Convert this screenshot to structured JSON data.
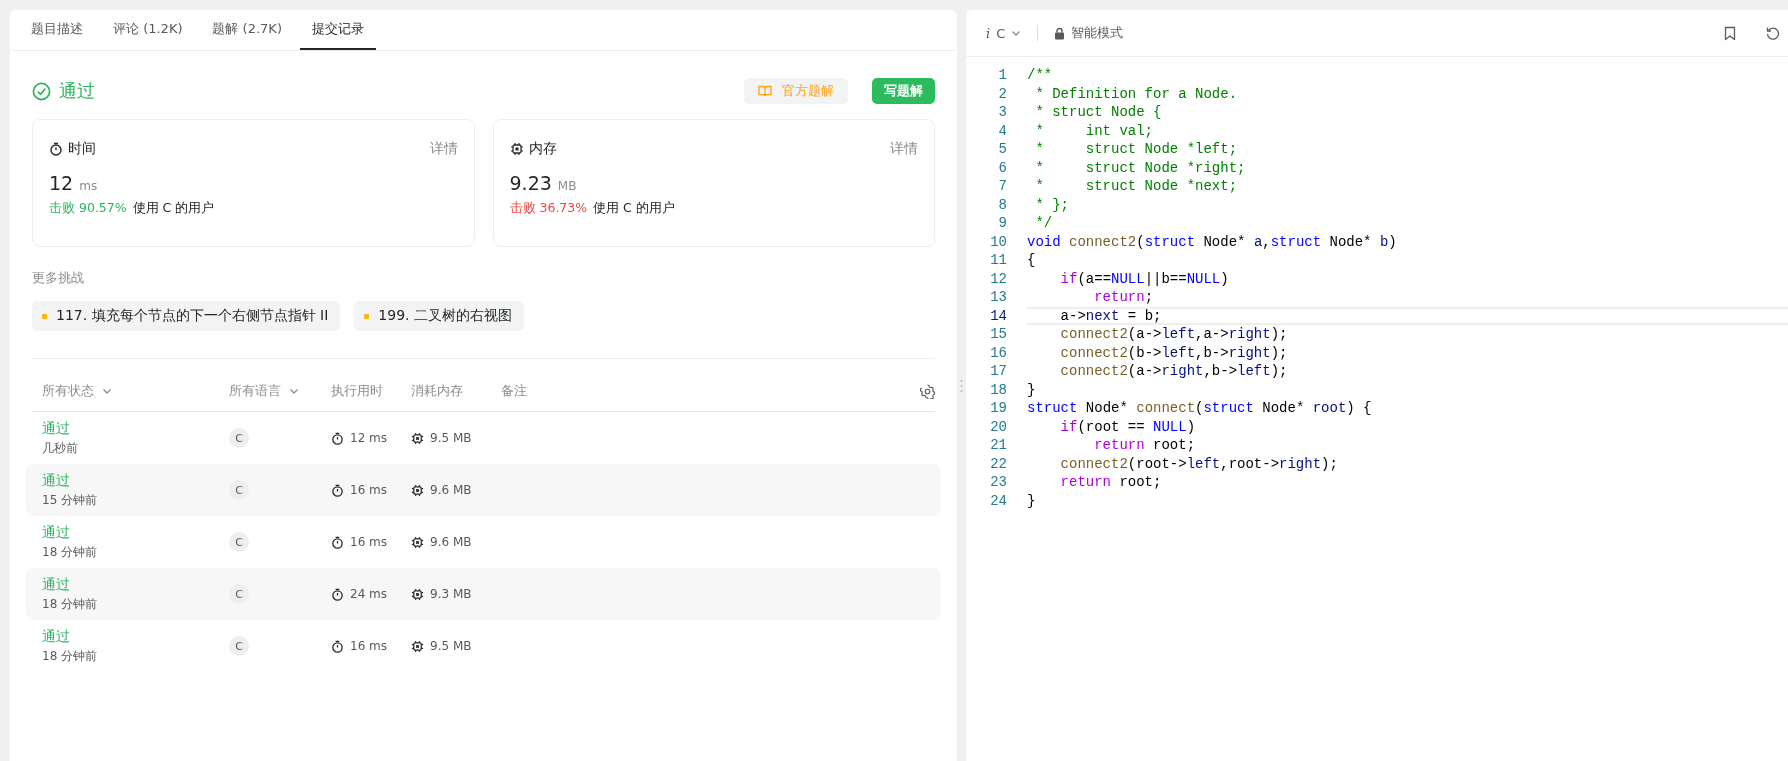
{
  "left_panel": {
    "tabs": [
      {
        "label": "题目描述",
        "selected": false
      },
      {
        "label": "评论 (1.2K)",
        "selected": false
      },
      {
        "label": "题解 (2.7K)",
        "selected": false
      },
      {
        "label": "提交记录",
        "selected": true
      }
    ],
    "result": {
      "status": "通过",
      "buttons": [
        {
          "kind": "official",
          "label": "官方题解"
        },
        {
          "kind": "write",
          "label": "写题解"
        }
      ]
    },
    "stats": [
      {
        "kind": "time",
        "title": "时间",
        "detail": "详情",
        "value": "12",
        "unit": "ms",
        "beat_label": "击败",
        "beat_percent": "90.57%",
        "color": "#2db55d",
        "suffix": "使用 C 的用户"
      },
      {
        "kind": "memory",
        "title": "内存",
        "detail": "详情",
        "value": "9.23",
        "unit": "MB",
        "beat_label": "击败",
        "beat_percent": "36.73%",
        "color": "#ef4743",
        "suffix": "使用 C 的用户"
      }
    ],
    "more_challenges": {
      "heading": "更多挑战",
      "items": [
        "117. 填充每个节点的下一个右侧节点指针 II",
        "199. 二叉树的右视图"
      ]
    },
    "submissions": {
      "columns": [
        {
          "label": "所有状态",
          "dropdown": true
        },
        {
          "label": "所有语言",
          "dropdown": true
        },
        {
          "label": "执行用时",
          "dropdown": false
        },
        {
          "label": "消耗内存",
          "dropdown": false
        },
        {
          "label": "备注",
          "dropdown": false
        }
      ],
      "rows": [
        {
          "status": "通过",
          "time_ago": "几秒前",
          "language": "C",
          "runtime": "12 ms",
          "memory": "9.5 MB"
        },
        {
          "status": "通过",
          "time_ago": "15 分钟前",
          "language": "C",
          "runtime": "16 ms",
          "memory": "9.6 MB"
        },
        {
          "status": "通过",
          "time_ago": "18 分钟前",
          "language": "C",
          "runtime": "16 ms",
          "memory": "9.6 MB"
        },
        {
          "status": "通过",
          "time_ago": "18 分钟前",
          "language": "C",
          "runtime": "24 ms",
          "memory": "9.3 MB"
        },
        {
          "status": "通过",
          "time_ago": "18 分钟前",
          "language": "C",
          "runtime": "16 ms",
          "memory": "9.5 MB"
        }
      ]
    }
  },
  "editor": {
    "lang_glyph": "i",
    "language": "C",
    "mode": "智能模式",
    "lines": [
      {
        "n": "1",
        "current": false,
        "tokens": [
          {
            "kind": "comment",
            "text": "/**"
          }
        ]
      },
      {
        "n": "2",
        "current": false,
        "tokens": [
          {
            "kind": "comment",
            "text": " * Definition for a Node."
          }
        ]
      },
      {
        "n": "3",
        "current": false,
        "tokens": [
          {
            "kind": "comment",
            "text": " * struct Node {"
          }
        ]
      },
      {
        "n": "4",
        "current": false,
        "tokens": [
          {
            "kind": "comment",
            "text": " *     int val;"
          }
        ]
      },
      {
        "n": "5",
        "current": false,
        "tokens": [
          {
            "kind": "comment",
            "text": " *     struct Node *left;"
          }
        ]
      },
      {
        "n": "6",
        "current": false,
        "tokens": [
          {
            "kind": "comment",
            "text": " *     struct Node *right;"
          }
        ]
      },
      {
        "n": "7",
        "current": false,
        "tokens": [
          {
            "kind": "comment",
            "text": " *     struct Node *next;"
          }
        ]
      },
      {
        "n": "8",
        "current": false,
        "tokens": [
          {
            "kind": "comment",
            "text": " * };"
          }
        ]
      },
      {
        "n": "9",
        "current": false,
        "tokens": [
          {
            "kind": "comment",
            "text": " */"
          }
        ]
      },
      {
        "n": "10",
        "current": false,
        "tokens": [
          {
            "kind": "keyword",
            "text": "void "
          },
          {
            "kind": "function",
            "text": "connect2"
          },
          {
            "kind": "plain",
            "text": "("
          },
          {
            "kind": "keyword",
            "text": "struct"
          },
          {
            "kind": "plain",
            "text": " Node* "
          },
          {
            "kind": "variable",
            "text": "a"
          },
          {
            "kind": "plain",
            "text": ","
          },
          {
            "kind": "keyword",
            "text": "struct"
          },
          {
            "kind": "plain",
            "text": " Node* "
          },
          {
            "kind": "variable",
            "text": "b"
          },
          {
            "kind": "plain",
            "text": ")"
          }
        ]
      },
      {
        "n": "11",
        "current": false,
        "tokens": [
          {
            "kind": "plain",
            "text": "{"
          }
        ]
      },
      {
        "n": "12",
        "current": false,
        "tokens": [
          {
            "kind": "control",
            "text": "    if"
          },
          {
            "kind": "plain",
            "text": "(a=="
          },
          {
            "kind": "keyword",
            "text": "NULL"
          },
          {
            "kind": "plain",
            "text": "||b=="
          },
          {
            "kind": "keyword",
            "text": "NULL"
          },
          {
            "kind": "plain",
            "text": ")"
          }
        ]
      },
      {
        "n": "13",
        "current": false,
        "tokens": [
          {
            "kind": "control",
            "text": "        return"
          },
          {
            "kind": "plain",
            "text": ";"
          }
        ]
      },
      {
        "n": "14",
        "current": true,
        "tokens": [
          {
            "kind": "plain",
            "text": "    a->"
          },
          {
            "kind": "variable",
            "text": "next"
          },
          {
            "kind": "plain",
            "text": " = b;"
          }
        ]
      },
      {
        "n": "15",
        "current": false,
        "tokens": [
          {
            "kind": "function",
            "text": "    connect2"
          },
          {
            "kind": "plain",
            "text": "(a->"
          },
          {
            "kind": "variable",
            "text": "left"
          },
          {
            "kind": "plain",
            "text": ",a->"
          },
          {
            "kind": "variable",
            "text": "right"
          },
          {
            "kind": "plain",
            "text": ");"
          }
        ]
      },
      {
        "n": "16",
        "current": false,
        "tokens": [
          {
            "kind": "function",
            "text": "    connect2"
          },
          {
            "kind": "plain",
            "text": "(b->"
          },
          {
            "kind": "variable",
            "text": "left"
          },
          {
            "kind": "plain",
            "text": ",b->"
          },
          {
            "kind": "variable",
            "text": "right"
          },
          {
            "kind": "plain",
            "text": ");"
          }
        ]
      },
      {
        "n": "17",
        "current": false,
        "tokens": [
          {
            "kind": "function",
            "text": "    connect2"
          },
          {
            "kind": "plain",
            "text": "(a->"
          },
          {
            "kind": "variable",
            "text": "right"
          },
          {
            "kind": "plain",
            "text": ",b->"
          },
          {
            "kind": "variable",
            "text": "left"
          },
          {
            "kind": "plain",
            "text": ");"
          }
        ]
      },
      {
        "n": "18",
        "current": false,
        "tokens": [
          {
            "kind": "plain",
            "text": "}"
          }
        ]
      },
      {
        "n": "19",
        "current": false,
        "tokens": [
          {
            "kind": "keyword",
            "text": "struct"
          },
          {
            "kind": "plain",
            "text": " Node* "
          },
          {
            "kind": "function",
            "text": "connect"
          },
          {
            "kind": "plain",
            "text": "("
          },
          {
            "kind": "keyword",
            "text": "struct"
          },
          {
            "kind": "plain",
            "text": " Node* "
          },
          {
            "kind": "variable",
            "text": "root"
          },
          {
            "kind": "plain",
            "text": ") {"
          }
        ]
      },
      {
        "n": "20",
        "current": false,
        "tokens": [
          {
            "kind": "control",
            "text": "    if"
          },
          {
            "kind": "plain",
            "text": "(root == "
          },
          {
            "kind": "keyword",
            "text": "NULL"
          },
          {
            "kind": "plain",
            "text": ")"
          }
        ]
      },
      {
        "n": "21",
        "current": false,
        "tokens": [
          {
            "kind": "control",
            "text": "        return"
          },
          {
            "kind": "plain",
            "text": " root;"
          }
        ]
      },
      {
        "n": "22",
        "current": false,
        "tokens": [
          {
            "kind": "function",
            "text": "    connect2"
          },
          {
            "kind": "plain",
            "text": "(root->"
          },
          {
            "kind": "variable",
            "text": "left"
          },
          {
            "kind": "plain",
            "text": ",root->"
          },
          {
            "kind": "variable",
            "text": "right"
          },
          {
            "kind": "plain",
            "text": ");"
          }
        ]
      },
      {
        "n": "23",
        "current": false,
        "tokens": [
          {
            "kind": "control",
            "text": "    return"
          },
          {
            "kind": "plain",
            "text": " root;"
          }
        ]
      },
      {
        "n": "24",
        "current": false,
        "tokens": [
          {
            "kind": "plain",
            "text": "}"
          }
        ]
      }
    ]
  }
}
